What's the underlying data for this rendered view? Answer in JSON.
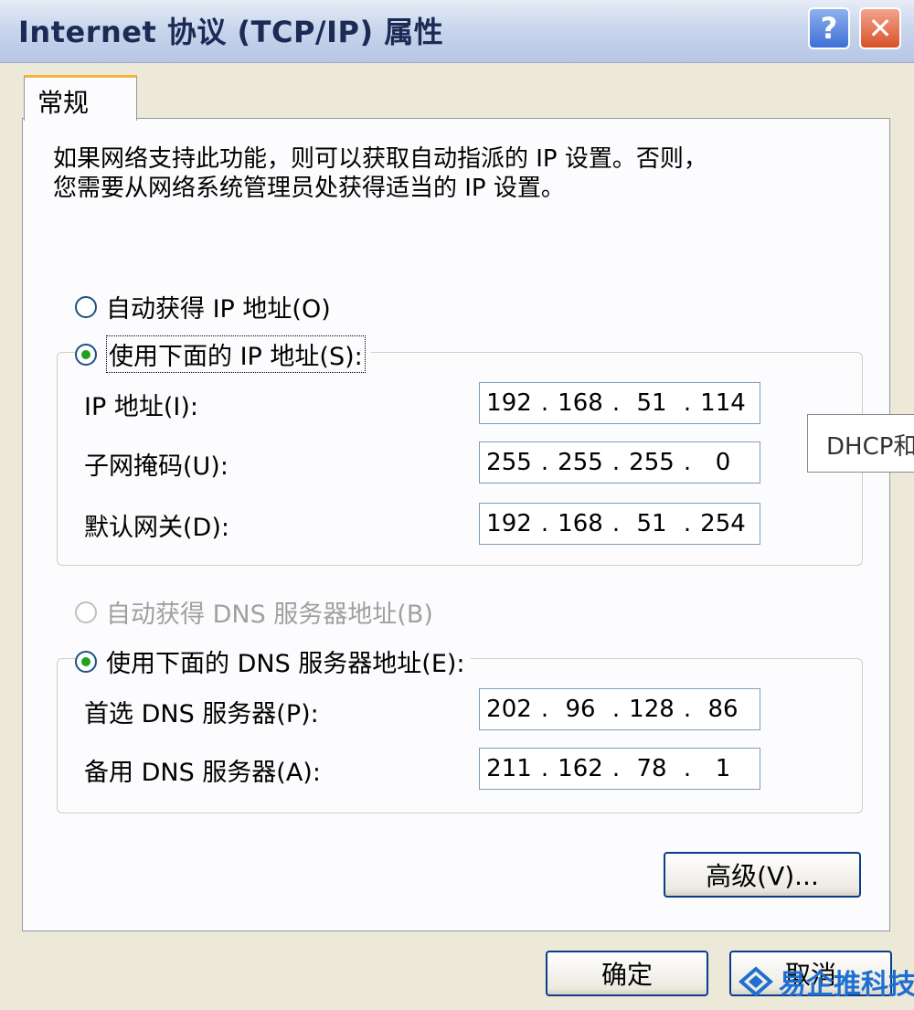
{
  "window": {
    "title": "Internet 协议 (TCP/IP) 属性",
    "help_label": "?",
    "close_label": "✕"
  },
  "tabs": [
    {
      "label": "常规"
    }
  ],
  "intro": "如果网络支持此功能，则可以获取自动指派的 IP 设置。否则，\n您需要从网络系统管理员处获得适当的 IP 设置。",
  "ip_options": {
    "auto": {
      "label": "自动获得 IP 地址(O)",
      "checked": false
    },
    "manual": {
      "label": "使用下面的 IP 地址(S):",
      "checked": true
    }
  },
  "ip_fields": [
    {
      "label": "IP 地址(I):",
      "octets": [
        "192",
        "168",
        "51",
        "114"
      ]
    },
    {
      "label": "子网掩码(U):",
      "octets": [
        "255",
        "255",
        "255",
        "0"
      ]
    },
    {
      "label": "默认网关(D):",
      "octets": [
        "192",
        "168",
        "51",
        "254"
      ]
    }
  ],
  "dns_options": {
    "auto": {
      "label": "自动获得 DNS 服务器地址(B)",
      "checked": false,
      "disabled": true
    },
    "manual": {
      "label": "使用下面的 DNS 服务器地址(E):",
      "checked": true
    }
  },
  "dns_fields": [
    {
      "label": "首选 DNS 服务器(P):",
      "octets": [
        "202",
        "96",
        "128",
        "86"
      ]
    },
    {
      "label": "备用 DNS 服务器(A):",
      "octets": [
        "211",
        "162",
        "78",
        "1"
      ]
    }
  ],
  "buttons": {
    "advanced": "高级(V)...",
    "ok": "确定",
    "cancel": "取消"
  },
  "tooltip": "DHCP和",
  "watermark": "易企推科技",
  "colors": {
    "accent": "#0b3c8c",
    "radio_dot": "#21a121",
    "tab_highlight": "#f5b140"
  }
}
